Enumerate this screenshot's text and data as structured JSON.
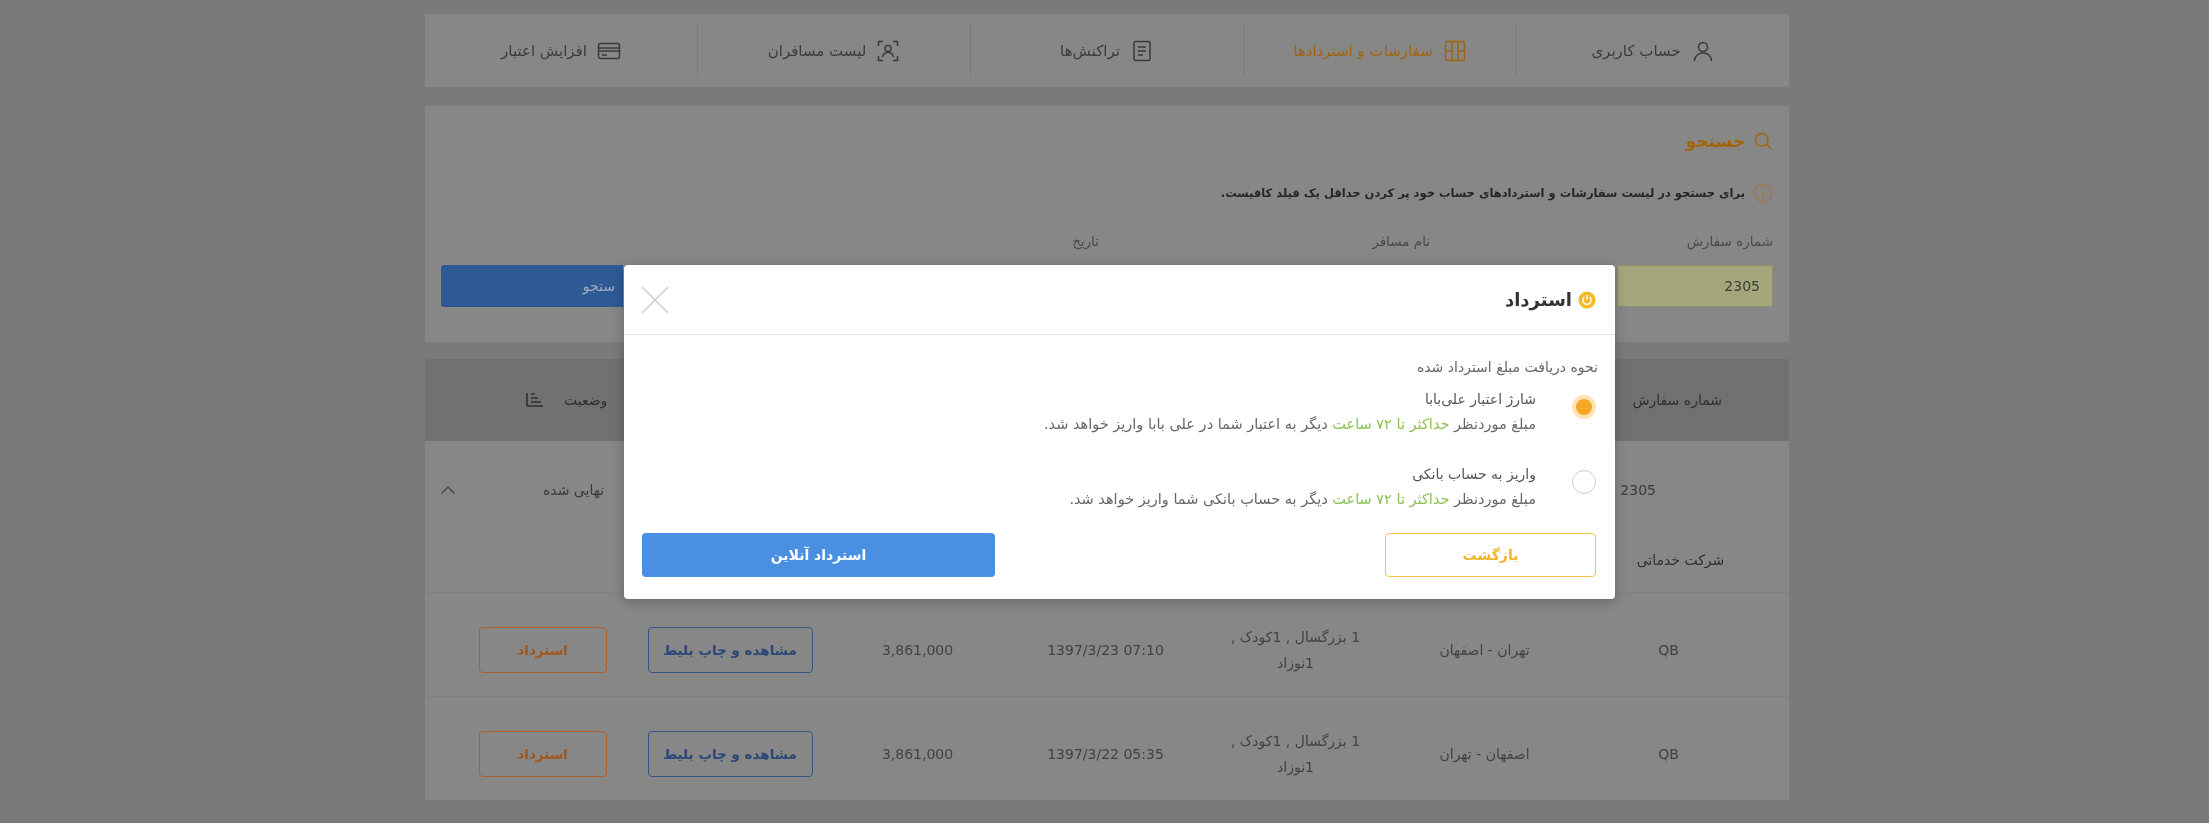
{
  "nav": {
    "items": [
      {
        "label": "حساب کاربری",
        "selected": false
      },
      {
        "label": "سفارشات و استردادها",
        "selected": true
      },
      {
        "label": "تراکنش‌ها",
        "selected": false
      },
      {
        "label": "لیست مسافران",
        "selected": false
      },
      {
        "label": "افزایش اعتبار",
        "selected": false
      }
    ]
  },
  "search": {
    "title": "جستجو",
    "hint": "برای جستجو در لیست سفارشات و استردادهای حساب خود پر کردن حداقل یک فیلد کافیست.",
    "fields": [
      {
        "label": "شماره سفارش",
        "value": "2305",
        "autofilled": true
      },
      {
        "label": "نام مسافر"
      },
      {
        "label": "تاریخ"
      }
    ],
    "button": {
      "label": "ستجو"
    }
  },
  "table": {
    "columns": [
      {
        "label": "شماره سفارش",
        "kind": "plain"
      },
      {
        "label": "وضعیت",
        "kind": "sortable"
      }
    ],
    "orders": [
      {
        "order_number": "2305",
        "status": "نهایی شده",
        "expanded": true,
        "details": {
          "columns": [
            {
              "label": "شرکت خدماتی"
            }
          ],
          "rows": [
            {
              "company": "QB",
              "route": "تهران - اصفهان",
              "passengers": "1 بزرگسال , 1کودک , 1نوزاد",
              "date_time": "1397/3/23 07:10",
              "price": "3,861,000",
              "actions": [
                {
                  "label": "مشاهده و چاپ بلیط",
                  "kind": "view"
                },
                {
                  "label": "استرداد",
                  "kind": "refund"
                }
              ]
            },
            {
              "company": "QB",
              "route": "اصفهان - تهران",
              "passengers": "1 بزرگسال , 1کودک , 1نوزاد",
              "date_time": "1397/3/22 05:35",
              "price": "3,861,000",
              "actions": [
                {
                  "label": "مشاهده و چاپ بلیط",
                  "kind": "view"
                },
                {
                  "label": "استرداد",
                  "kind": "refund"
                }
              ]
            }
          ]
        }
      }
    ]
  },
  "refund_dialog": {
    "title": "استرداد",
    "prompt": "نحوه دریافت مبلغ استرداد شده",
    "options": [
      {
        "label": "شارژ اعتبار علی‌بابا",
        "selected": true,
        "description": [
          {
            "text": "مبلغ موردنظر ",
            "highlight": false
          },
          {
            "text": "حداکثر تا ۷۲ ساعت",
            "highlight": true
          },
          {
            "text": " دیگر به اعتبار شما در علی بابا واریز خواهد شد.",
            "highlight": false
          }
        ]
      },
      {
        "label": "واریز به حساب بانکی",
        "selected": false,
        "description": [
          {
            "text": "مبلغ موردنظر ",
            "highlight": false
          },
          {
            "text": "حداکثر تا ۷۲ ساعت",
            "highlight": true
          },
          {
            "text": " دیگر به حساب بانکی شما واریز خواهد شد.",
            "highlight": false
          }
        ]
      }
    ],
    "buttons": [
      {
        "label": "بازگشت",
        "kind": "secondary"
      },
      {
        "label": "استرداد آنلاین",
        "kind": "primary"
      }
    ]
  }
}
